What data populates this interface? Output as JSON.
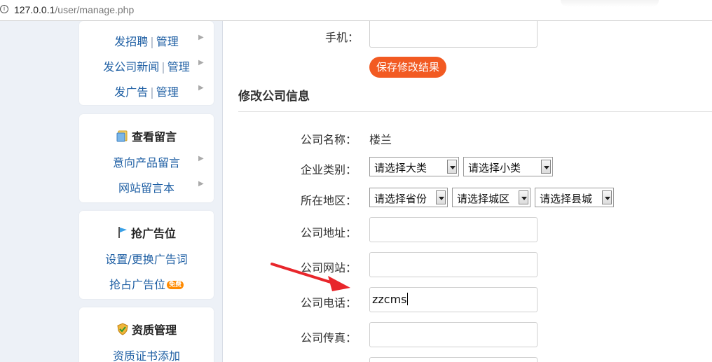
{
  "address_bar": {
    "host": "127.0.0.1",
    "path": "/user/manage.php"
  },
  "sidebar": {
    "recruit": {
      "left": "发招聘",
      "right": "管理"
    },
    "news": {
      "left": "发公司新闻",
      "right": "管理"
    },
    "ads": {
      "left": "发广告",
      "right": "管理"
    },
    "messages": {
      "title": "查看留言",
      "items": [
        "意向产品留言",
        "网站留言本"
      ]
    },
    "adspace": {
      "title": "抢广告位",
      "items": [
        "设置/更换广告词",
        "抢占广告位"
      ],
      "badge": "免费"
    },
    "qualification": {
      "title": "资质管理",
      "items": [
        "资质证书添加"
      ]
    }
  },
  "form": {
    "mobile_label": "手机：",
    "save_label": "保存修改结果",
    "section_title": "修改公司信息",
    "company_name_label": "公司名称：",
    "company_name_value": "楼兰",
    "category_label": "企业类别：",
    "category_major": "请选择大类",
    "category_minor": "请选择小类",
    "region_label": "所在地区：",
    "province": "请选择省份",
    "city": "请选择城区",
    "county": "请选择县城",
    "address_label": "公司地址：",
    "website_label": "公司网站：",
    "phone_label": "公司电话：",
    "phone_value": "zzcms",
    "fax_label": "公司传真："
  },
  "colors": {
    "accent": "#f25a22",
    "link": "#1d5ea3",
    "arrow": "#e8262b"
  }
}
